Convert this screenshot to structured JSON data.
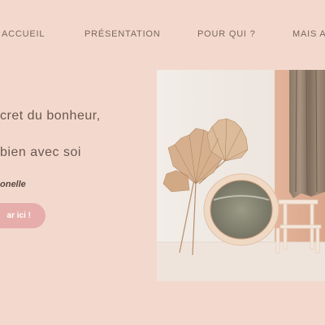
{
  "nav": {
    "items": [
      {
        "label": "ACCUEIL"
      },
      {
        "label": "PRÉSENTATION"
      },
      {
        "label": "POUR QUI ?"
      },
      {
        "label": "MAIS AU"
      }
    ]
  },
  "hero": {
    "line1": "cret du bonheur,",
    "line2": "bien avec soi",
    "signature": "onelle",
    "cta_label": "ar ici !"
  },
  "colors": {
    "background": "#f3d9cd",
    "accent": "#e6adaa",
    "text": "#6b5650"
  },
  "photo": {
    "subject": "dried palm leaves, round mirror, wooden step stool, curtain"
  }
}
